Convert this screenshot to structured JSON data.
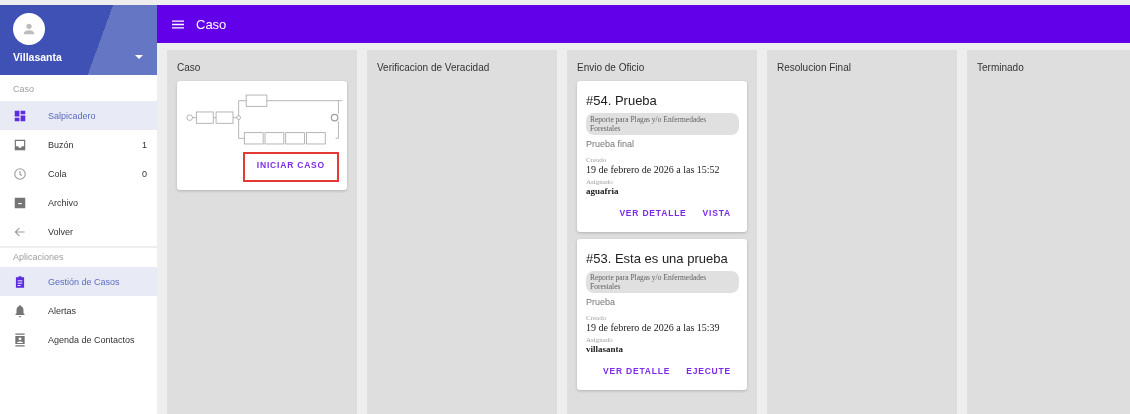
{
  "sidebar": {
    "user": "Villasanta",
    "sections": [
      {
        "title": "Caso",
        "items": [
          {
            "label": "Salpicadero",
            "selected": true
          },
          {
            "label": "Buzón",
            "count": "1",
            "selected": false
          },
          {
            "label": "Cola",
            "count": "0",
            "selected": false
          },
          {
            "label": "Archivo",
            "selected": false
          },
          {
            "label": "Volver",
            "selected": false
          }
        ]
      },
      {
        "title": "Aplicaciones",
        "items": [
          {
            "label": "Gestión de Casos",
            "selected": true
          },
          {
            "label": "Alertas",
            "selected": false
          },
          {
            "label": "Agenda de Contactos",
            "selected": false
          }
        ]
      }
    ]
  },
  "header": {
    "title": "Caso"
  },
  "columns": [
    {
      "title": "Caso",
      "start_card": {
        "button": "INICIAR CASO",
        "highlighted": true
      }
    },
    {
      "title": "Verificacion de Veracidad"
    },
    {
      "title": "Envio de Oficio",
      "cards": [
        {
          "title": "#54. Prueba",
          "tag": "Reporte para Plagas y/o Enfermedades Forestales",
          "description": "Prueba final",
          "created_label": "Creado",
          "created": "19 de febrero de 2026 a las 15:52",
          "assigned_label": "Asignado",
          "assigned": "aguafria",
          "actions": [
            "VER DETALLE",
            "VISTA"
          ]
        },
        {
          "title": "#53. Esta es una prueba",
          "tag": "Reporte para Plagas y/o Enfermedades Forestales",
          "description": "Prueba",
          "created_label": "Creado",
          "created": "19 de febrero de 2026 a las 15:39",
          "assigned_label": "Asignado",
          "assigned": "villasanta",
          "actions": [
            "VER DETALLE",
            "EJECUTE"
          ]
        }
      ]
    },
    {
      "title": "Resolucion Final"
    },
    {
      "title": "Terminado"
    }
  ]
}
